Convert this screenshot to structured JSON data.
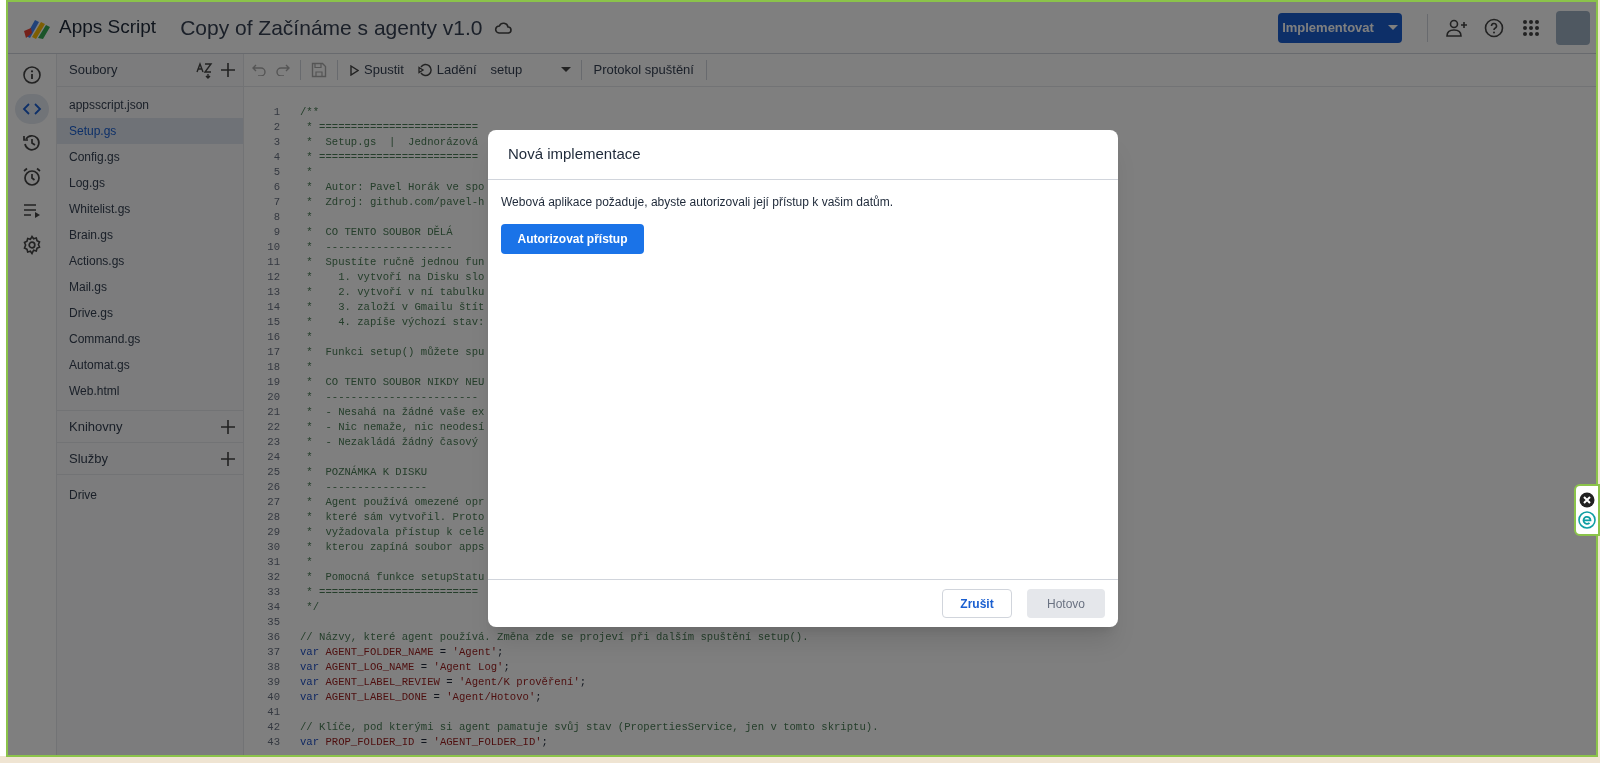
{
  "app": {
    "name": "Apps Script",
    "project_title": "Copy of Začínáme s agenty v1.0"
  },
  "header": {
    "deploy_button": "Implementovat"
  },
  "rail": [
    {
      "kind": "info",
      "selected": false
    },
    {
      "kind": "code",
      "selected": true
    },
    {
      "kind": "history",
      "selected": false
    },
    {
      "kind": "triggers",
      "selected": false
    },
    {
      "kind": "executions",
      "selected": false
    },
    {
      "kind": "settings",
      "selected": false
    }
  ],
  "toolbar": {
    "run": "Spustit",
    "debug": "Ladění",
    "function_select": "setup",
    "log": "Protokol spuštění"
  },
  "files": {
    "title": "Soubory",
    "items": [
      {
        "name": "appsscript.json",
        "selected": false
      },
      {
        "name": "Setup.gs",
        "selected": true
      },
      {
        "name": "Config.gs",
        "selected": false
      },
      {
        "name": "Log.gs",
        "selected": false
      },
      {
        "name": "Whitelist.gs",
        "selected": false
      },
      {
        "name": "Brain.gs",
        "selected": false
      },
      {
        "name": "Actions.gs",
        "selected": false
      },
      {
        "name": "Mail.gs",
        "selected": false
      },
      {
        "name": "Drive.gs",
        "selected": false
      },
      {
        "name": "Command.gs",
        "selected": false
      },
      {
        "name": "Automat.gs",
        "selected": false
      },
      {
        "name": "Web.html",
        "selected": false
      }
    ]
  },
  "sections": [
    {
      "title": "Knihovny"
    },
    {
      "title": "Služby",
      "items": [
        "Drive"
      ]
    }
  ],
  "editor": {
    "lines": [
      {
        "number": "1",
        "parts": [
          {
            "kind": "comment",
            "text": "/**"
          }
        ]
      },
      {
        "number": "2",
        "parts": [
          {
            "kind": "comment",
            "text": " * ========================="
          }
        ]
      },
      {
        "number": "3",
        "parts": [
          {
            "kind": "comment",
            "text": " *  Setup.gs  |  Jednorázová"
          }
        ]
      },
      {
        "number": "4",
        "parts": [
          {
            "kind": "comment",
            "text": " * ========================="
          }
        ]
      },
      {
        "number": "5",
        "parts": [
          {
            "kind": "comment",
            "text": " *"
          }
        ]
      },
      {
        "number": "6",
        "parts": [
          {
            "kind": "comment",
            "text": " *  Autor: Pavel Horák ve spo"
          }
        ]
      },
      {
        "number": "7",
        "parts": [
          {
            "kind": "comment",
            "text": " *  Zdroj: github.com/pavel-h"
          }
        ]
      },
      {
        "number": "8",
        "parts": [
          {
            "kind": "comment",
            "text": " *"
          }
        ]
      },
      {
        "number": "9",
        "parts": [
          {
            "kind": "comment",
            "text": " *  CO TENTO SOUBOR DĚLÁ"
          }
        ]
      },
      {
        "number": "10",
        "parts": [
          {
            "kind": "comment",
            "text": " *  --------------------"
          }
        ]
      },
      {
        "number": "11",
        "parts": [
          {
            "kind": "comment",
            "text": " *  Spustíte ručně jednou fun"
          }
        ]
      },
      {
        "number": "12",
        "parts": [
          {
            "kind": "comment",
            "text": " *    1. vytvoří na Disku slo"
          }
        ]
      },
      {
        "number": "13",
        "parts": [
          {
            "kind": "comment",
            "text": " *    2. vytvoří v ní tabulku"
          }
        ]
      },
      {
        "number": "14",
        "parts": [
          {
            "kind": "comment",
            "text": " *    3. založí v Gmailu štít"
          }
        ]
      },
      {
        "number": "15",
        "parts": [
          {
            "kind": "comment",
            "text": " *    4. zapíše výchozí stav:"
          }
        ]
      },
      {
        "number": "16",
        "parts": [
          {
            "kind": "comment",
            "text": " *"
          }
        ]
      },
      {
        "number": "17",
        "parts": [
          {
            "kind": "comment",
            "text": " *  Funkci setup() můžete spu"
          }
        ]
      },
      {
        "number": "18",
        "parts": [
          {
            "kind": "comment",
            "text": " *"
          }
        ]
      },
      {
        "number": "19",
        "parts": [
          {
            "kind": "comment",
            "text": " *  CO TENTO SOUBOR NIKDY NEU"
          }
        ]
      },
      {
        "number": "20",
        "parts": [
          {
            "kind": "comment",
            "text": " *  ------------------------"
          }
        ]
      },
      {
        "number": "21",
        "parts": [
          {
            "kind": "comment",
            "text": " *  - Nesahá na žádné vaše ex"
          }
        ]
      },
      {
        "number": "22",
        "parts": [
          {
            "kind": "comment",
            "text": " *  - Nic nemaže, nic neodesí"
          }
        ]
      },
      {
        "number": "23",
        "parts": [
          {
            "kind": "comment",
            "text": " *  - Nezakládá žádný časový"
          }
        ]
      },
      {
        "number": "24",
        "parts": [
          {
            "kind": "comment",
            "text": " *"
          }
        ]
      },
      {
        "number": "25",
        "parts": [
          {
            "kind": "comment",
            "text": " *  POZNÁMKA K DISKU"
          }
        ]
      },
      {
        "number": "26",
        "parts": [
          {
            "kind": "comment",
            "text": " *  ----------------"
          }
        ]
      },
      {
        "number": "27",
        "parts": [
          {
            "kind": "comment",
            "text": " *  Agent používá omezené opr"
          }
        ]
      },
      {
        "number": "28",
        "parts": [
          {
            "kind": "comment",
            "text": " *  které sám vytvořil. Proto"
          }
        ]
      },
      {
        "number": "29",
        "parts": [
          {
            "kind": "comment",
            "text": " *  vyžadovala přístup k celé"
          }
        ]
      },
      {
        "number": "30",
        "parts": [
          {
            "kind": "comment",
            "text": " *  kterou zapíná soubor apps"
          }
        ]
      },
      {
        "number": "31",
        "parts": [
          {
            "kind": "comment",
            "text": " *"
          }
        ]
      },
      {
        "number": "32",
        "parts": [
          {
            "kind": "comment",
            "text": " *  Pomocná funkce setupStatu"
          }
        ]
      },
      {
        "number": "33",
        "parts": [
          {
            "kind": "comment",
            "text": " * ========================="
          }
        ]
      },
      {
        "number": "34",
        "parts": [
          {
            "kind": "comment",
            "text": " */"
          }
        ]
      },
      {
        "number": "35"
      },
      {
        "number": "36",
        "parts": [
          {
            "kind": "comment",
            "text": "// Názvy, které agent používá. Změna zde se projeví při dalším spuštění setup()."
          }
        ]
      },
      {
        "number": "37",
        "parts": [
          {
            "kind": "keyword",
            "text": "var "
          },
          {
            "kind": "name",
            "text": "AGENT_FOLDER_NAME"
          },
          {
            "kind": "plain",
            "text": " = "
          },
          {
            "kind": "string",
            "text": "'Agent'"
          },
          {
            "kind": "plain",
            "text": ";"
          }
        ]
      },
      {
        "number": "38",
        "parts": [
          {
            "kind": "keyword",
            "text": "var "
          },
          {
            "kind": "name",
            "text": "AGENT_LOG_NAME"
          },
          {
            "kind": "plain",
            "text": " = "
          },
          {
            "kind": "string",
            "text": "'Agent Log'"
          },
          {
            "kind": "plain",
            "text": ";"
          }
        ]
      },
      {
        "number": "39",
        "parts": [
          {
            "kind": "keyword",
            "text": "var "
          },
          {
            "kind": "name",
            "text": "AGENT_LABEL_REVIEW"
          },
          {
            "kind": "plain",
            "text": " = "
          },
          {
            "kind": "string",
            "text": "'Agent/K prověření'"
          },
          {
            "kind": "plain",
            "text": ";"
          }
        ]
      },
      {
        "number": "40",
        "parts": [
          {
            "kind": "keyword",
            "text": "var "
          },
          {
            "kind": "name",
            "text": "AGENT_LABEL_DONE"
          },
          {
            "kind": "plain",
            "text": " = "
          },
          {
            "kind": "string",
            "text": "'Agent/Hotovo'"
          },
          {
            "kind": "plain",
            "text": ";"
          }
        ]
      },
      {
        "number": "41"
      },
      {
        "number": "42",
        "parts": [
          {
            "kind": "comment",
            "text": "// Klíče, pod kterými si agent pamatuje svůj stav (PropertiesService, jen v tomto skriptu)."
          }
        ]
      },
      {
        "number": "43",
        "parts": [
          {
            "kind": "keyword",
            "text": "var "
          },
          {
            "kind": "name",
            "text": "PROP_FOLDER_ID"
          },
          {
            "kind": "plain",
            "text": " = "
          },
          {
            "kind": "string",
            "text": "'AGENT_FOLDER_ID'"
          },
          {
            "kind": "plain",
            "text": ";"
          }
        ]
      }
    ]
  },
  "dialog": {
    "title": "Nová implementace",
    "message": "Webová aplikace požaduje, abyste autorizovali její přístup k vašim datům.",
    "authorize_button": "Autorizovat přístup",
    "cancel_button": "Zrušit",
    "done_button": {
      "label": "Hotovo",
      "disabled": true
    }
  }
}
